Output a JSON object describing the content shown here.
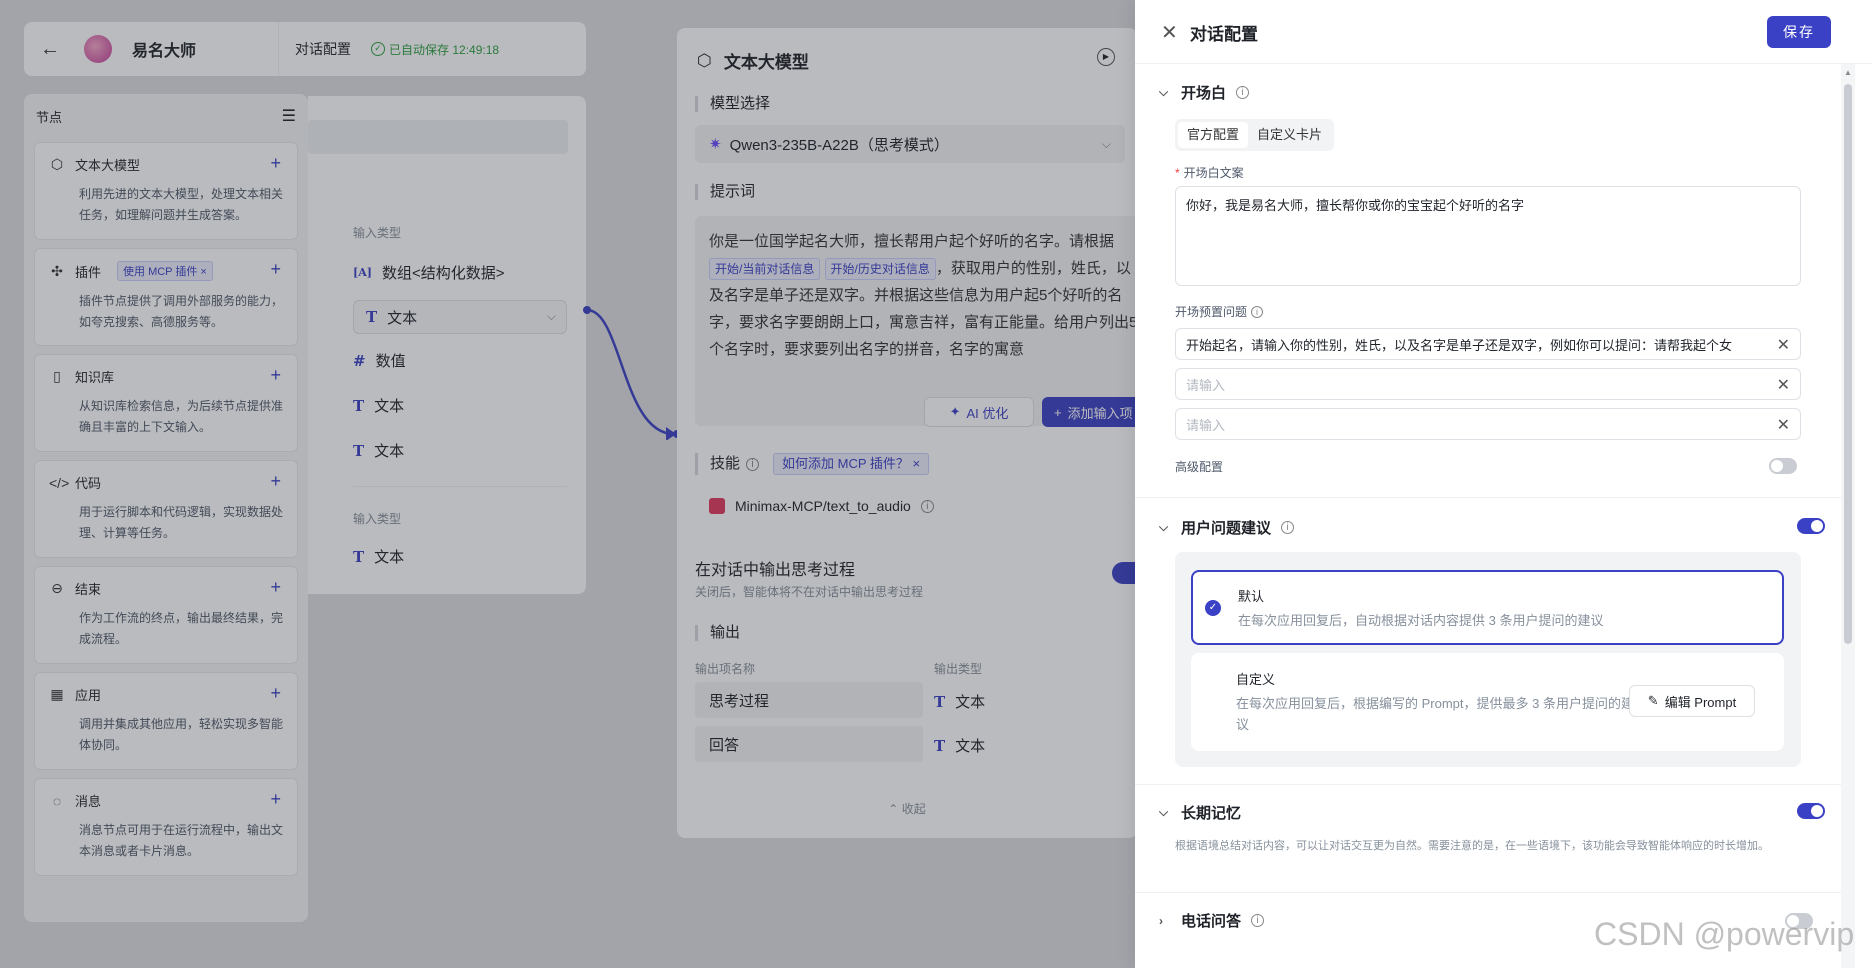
{
  "header": {
    "app_name": "易名大师",
    "tab": "对话配置",
    "autosave": "已自动保存 12:49:18"
  },
  "node_panel": {
    "title": "节点",
    "items": [
      {
        "title": "文本大模型",
        "desc": "利用先进的文本大模型，处理文本相关任务，如理解问题并生成答案。",
        "icon": "cube-icon"
      },
      {
        "title": "插件",
        "tag": "使用 MCP 插件 ×",
        "desc": "插件节点提供了调用外部服务的能力，如夸克搜索、高德服务等。",
        "icon": "puzzle-icon"
      },
      {
        "title": "知识库",
        "desc": "从知识库检索信息，为后续节点提供准确且丰富的上下文输入。",
        "icon": "book-icon"
      },
      {
        "title": "代码",
        "desc": "用于运行脚本和代码逻辑，实现数据处理、计算等任务。",
        "icon": "code-icon"
      },
      {
        "title": "结束",
        "desc": "作为工作流的终点，输出最终结果，完成流程。",
        "icon": "end-icon"
      },
      {
        "title": "应用",
        "desc": "调用并集成其他应用，轻松实现多智能体协同。",
        "icon": "grid-icon"
      },
      {
        "title": "消息",
        "desc": "消息节点可用于在运行流程中，输出文本消息或者卡片消息。",
        "icon": "message-icon"
      }
    ]
  },
  "input_node": {
    "label1": "输入类型",
    "array_type": "数组<结构化数据>",
    "select_value": "文本",
    "type_number": "数值",
    "type_text1": "文本",
    "type_text2": "文本",
    "label2": "输入类型",
    "type_text3": "文本"
  },
  "llm_node": {
    "title": "文本大模型",
    "model_label": "模型选择",
    "model_value": "Qwen3-235B-A22B（思考模式）",
    "prompt_label": "提示词",
    "prompt_part1": "你是一位国学起名大师，擅长帮用户起个好听的名字。请根据",
    "chip1": "开始/当前对话信息",
    "chip2": "开始/历史对话信息",
    "prompt_part2": "，获取用户的性别，姓氏，以及名字是单子还是双字。并根据这些信息为用户起5个好听的名字，要求名字要朗朗上口，寓意吉祥，富有正能量。给用户列出5个名字时，要求要列出名字的拼音，名字的寓意",
    "ai_optimize": "AI 优化",
    "add_var": "添加输入项",
    "skill_label": "技能",
    "skill_chip": "如何添加 MCP 插件？ ×",
    "mcp_name": "Minimax-MCP/text_to_audio",
    "think_title": "在对话中输出思考过程",
    "think_desc": "关闭后，智能体将不在对话中输出思考过程",
    "output_label": "输出",
    "out_col_name": "输出项名称",
    "out_col_type": "输出类型",
    "outputs": [
      {
        "name": "思考过程",
        "type": "文本"
      },
      {
        "name": "回答",
        "type": "文本"
      }
    ],
    "fold": "收起"
  },
  "drawer": {
    "title": "对话配置",
    "save": "保存",
    "opening": {
      "title": "开场白",
      "seg_official": "官方配置",
      "seg_custom": "自定义卡片",
      "text_label": "开场白文案",
      "text_value": "你好，我是易名大师，擅长帮你或你的宝宝起个好听的名字",
      "preset_label": "开场预置问题",
      "preset_q1": "开始起名，请输入你的性别，姓氏，以及名字是单子还是双字，例如你可以提问：请帮我起个女",
      "placeholder": "请输入",
      "advanced": "高级配置"
    },
    "suggest": {
      "title": "用户问题建议",
      "default_title": "默认",
      "default_desc": "在每次应用回复后，自动根据对话内容提供 3 条用户提问的建议",
      "custom_title": "自定义",
      "custom_desc": "在每次应用回复后，根据编写的 Prompt，提供最多 3 条用户提问的建议",
      "edit_btn": "编辑 Prompt"
    },
    "memory": {
      "title": "长期记忆",
      "desc": "根据语境总结对话内容，可以让对话交互更为自然。需要注意的是，在一些语境下，该功能会导致智能体响应的时长增加。"
    },
    "phone": {
      "title": "电话问答"
    }
  },
  "watermark": "CSDN @powervip"
}
